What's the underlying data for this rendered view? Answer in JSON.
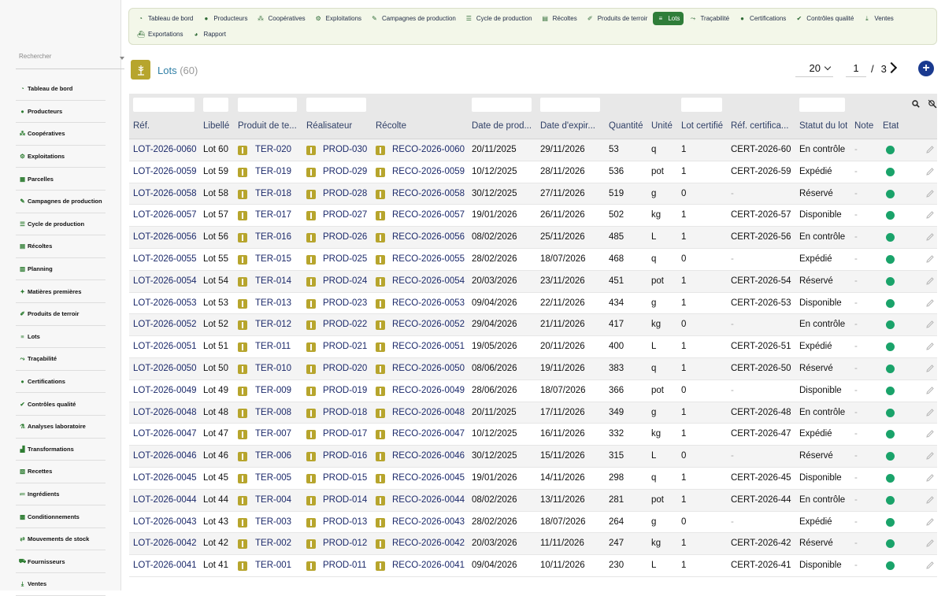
{
  "sidebar": {
    "search_placeholder": "Rechercher",
    "items": [
      {
        "label": "Tableau de bord",
        "icon": "dashboard-icon"
      },
      {
        "label": "Producteurs",
        "icon": "person-icon"
      },
      {
        "label": "Coopératives",
        "icon": "group-icon"
      },
      {
        "label": "Exploitations",
        "icon": "tractor-icon"
      },
      {
        "label": "Parcelles",
        "icon": "plot-icon"
      },
      {
        "label": "Campagnes de production",
        "icon": "campaign-icon"
      },
      {
        "label": "Cycle de production",
        "icon": "list-icon"
      },
      {
        "label": "Récoltes",
        "icon": "harvest-icon"
      },
      {
        "label": "Planning",
        "icon": "calendar-icon"
      },
      {
        "label": "Matières premières",
        "icon": "raw-material-icon"
      },
      {
        "label": "Produits de terroir",
        "icon": "product-icon"
      },
      {
        "label": "Lots",
        "icon": "lots-icon"
      },
      {
        "label": "Traçabilité",
        "icon": "trace-icon"
      },
      {
        "label": "Certifications",
        "icon": "certification-icon"
      },
      {
        "label": "Contrôles qualité",
        "icon": "quality-icon"
      },
      {
        "label": "Analyses laboratoire",
        "icon": "lab-icon"
      },
      {
        "label": "Transformations",
        "icon": "transform-icon"
      },
      {
        "label": "Recettes",
        "icon": "recipe-icon"
      },
      {
        "label": "Ingrédients",
        "icon": "ingredient-icon"
      },
      {
        "label": "Conditionnements",
        "icon": "packaging-icon"
      },
      {
        "label": "Mouvements de stock",
        "icon": "stock-icon"
      },
      {
        "label": "Fournisseurs",
        "icon": "supplier-icon"
      },
      {
        "label": "Ventes",
        "icon": "sales-icon"
      }
    ]
  },
  "topnav": {
    "row1": [
      {
        "label": "Tableau de bord",
        "icon": "dashboard-icon",
        "active": false
      },
      {
        "label": "Producteurs",
        "icon": "person-icon",
        "active": false
      },
      {
        "label": "Coopératives",
        "icon": "group-icon",
        "active": false
      },
      {
        "label": "Exploitations",
        "icon": "tractor-icon",
        "active": false
      },
      {
        "label": "Campagnes de production",
        "icon": "campaign-icon",
        "active": false
      },
      {
        "label": "Cycle de production",
        "icon": "list-icon",
        "active": false
      },
      {
        "label": "Récoltes",
        "icon": "harvest-icon",
        "active": false
      },
      {
        "label": "Produits de terroir",
        "icon": "product-icon",
        "active": false
      },
      {
        "label": "Lots",
        "icon": "lots-icon",
        "active": true
      },
      {
        "label": "Traçabilité",
        "icon": "trace-icon",
        "active": false
      },
      {
        "label": "Certifications",
        "icon": "certification-icon",
        "active": false
      },
      {
        "label": "Contrôles qualité",
        "icon": "quality-icon",
        "active": false
      },
      {
        "label": "Ventes",
        "icon": "sales-icon",
        "active": false
      }
    ],
    "row2": [
      {
        "label": "Exportations",
        "icon": "export-icon",
        "active": false
      },
      {
        "label": "Rapport",
        "icon": "report-icon",
        "active": false
      }
    ]
  },
  "page": {
    "title": "Lots",
    "count": "(60)"
  },
  "pagination": {
    "page_size": "20",
    "current_page": "1",
    "separator": "/",
    "total_pages": "3"
  },
  "table": {
    "columns": [
      "Réf.",
      "Libellé",
      "Produit de te...",
      "Réalisateur",
      "Récolte",
      "Date de prod...",
      "Date d'expir...",
      "Quantité",
      "Unité",
      "Lot certifié",
      "Réf. certifica...",
      "Statut du lot",
      "Note",
      "État"
    ],
    "rows": [
      {
        "ref": "LOT-2026-0060",
        "libelle": "Lot 60",
        "produit": "TER-020",
        "realisateur": "PROD-030",
        "recolte": "RECO-2026-0060",
        "date_prod": "20/11/2025",
        "date_exp": "29/11/2026",
        "quantite": "53",
        "unite": "q",
        "certifie": "1",
        "ref_cert": "CERT-2026-60",
        "statut": "En contrôle",
        "note": "-"
      },
      {
        "ref": "LOT-2026-0059",
        "libelle": "Lot 59",
        "produit": "TER-019",
        "realisateur": "PROD-029",
        "recolte": "RECO-2026-0059",
        "date_prod": "10/12/2025",
        "date_exp": "28/11/2026",
        "quantite": "536",
        "unite": "pot",
        "certifie": "1",
        "ref_cert": "CERT-2026-59",
        "statut": "Expédié",
        "note": "-"
      },
      {
        "ref": "LOT-2026-0058",
        "libelle": "Lot 58",
        "produit": "TER-018",
        "realisateur": "PROD-028",
        "recolte": "RECO-2026-0058",
        "date_prod": "30/12/2025",
        "date_exp": "27/11/2026",
        "quantite": "519",
        "unite": "g",
        "certifie": "0",
        "ref_cert": "-",
        "statut": "Réservé",
        "note": "-"
      },
      {
        "ref": "LOT-2026-0057",
        "libelle": "Lot 57",
        "produit": "TER-017",
        "realisateur": "PROD-027",
        "recolte": "RECO-2026-0057",
        "date_prod": "19/01/2026",
        "date_exp": "26/11/2026",
        "quantite": "502",
        "unite": "kg",
        "certifie": "1",
        "ref_cert": "CERT-2026-57",
        "statut": "Disponible",
        "note": "-"
      },
      {
        "ref": "LOT-2026-0056",
        "libelle": "Lot 56",
        "produit": "TER-016",
        "realisateur": "PROD-026",
        "recolte": "RECO-2026-0056",
        "date_prod": "08/02/2026",
        "date_exp": "25/11/2026",
        "quantite": "485",
        "unite": "L",
        "certifie": "1",
        "ref_cert": "CERT-2026-56",
        "statut": "En contrôle",
        "note": "-"
      },
      {
        "ref": "LOT-2026-0055",
        "libelle": "Lot 55",
        "produit": "TER-015",
        "realisateur": "PROD-025",
        "recolte": "RECO-2026-0055",
        "date_prod": "28/02/2026",
        "date_exp": "18/07/2026",
        "quantite": "468",
        "unite": "q",
        "certifie": "0",
        "ref_cert": "-",
        "statut": "Expédié",
        "note": "-"
      },
      {
        "ref": "LOT-2026-0054",
        "libelle": "Lot 54",
        "produit": "TER-014",
        "realisateur": "PROD-024",
        "recolte": "RECO-2026-0054",
        "date_prod": "20/03/2026",
        "date_exp": "23/11/2026",
        "quantite": "451",
        "unite": "pot",
        "certifie": "1",
        "ref_cert": "CERT-2026-54",
        "statut": "Réservé",
        "note": "-"
      },
      {
        "ref": "LOT-2026-0053",
        "libelle": "Lot 53",
        "produit": "TER-013",
        "realisateur": "PROD-023",
        "recolte": "RECO-2026-0053",
        "date_prod": "09/04/2026",
        "date_exp": "22/11/2026",
        "quantite": "434",
        "unite": "g",
        "certifie": "1",
        "ref_cert": "CERT-2026-53",
        "statut": "Disponible",
        "note": "-"
      },
      {
        "ref": "LOT-2026-0052",
        "libelle": "Lot 52",
        "produit": "TER-012",
        "realisateur": "PROD-022",
        "recolte": "RECO-2026-0052",
        "date_prod": "29/04/2026",
        "date_exp": "21/11/2026",
        "quantite": "417",
        "unite": "kg",
        "certifie": "0",
        "ref_cert": "-",
        "statut": "En contrôle",
        "note": "-"
      },
      {
        "ref": "LOT-2026-0051",
        "libelle": "Lot 51",
        "produit": "TER-011",
        "realisateur": "PROD-021",
        "recolte": "RECO-2026-0051",
        "date_prod": "19/05/2026",
        "date_exp": "20/11/2026",
        "quantite": "400",
        "unite": "L",
        "certifie": "1",
        "ref_cert": "CERT-2026-51",
        "statut": "Expédié",
        "note": "-"
      },
      {
        "ref": "LOT-2026-0050",
        "libelle": "Lot 50",
        "produit": "TER-010",
        "realisateur": "PROD-020",
        "recolte": "RECO-2026-0050",
        "date_prod": "08/06/2026",
        "date_exp": "19/11/2026",
        "quantite": "383",
        "unite": "q",
        "certifie": "1",
        "ref_cert": "CERT-2026-50",
        "statut": "Réservé",
        "note": "-"
      },
      {
        "ref": "LOT-2026-0049",
        "libelle": "Lot 49",
        "produit": "TER-009",
        "realisateur": "PROD-019",
        "recolte": "RECO-2026-0049",
        "date_prod": "28/06/2026",
        "date_exp": "18/07/2026",
        "quantite": "366",
        "unite": "pot",
        "certifie": "0",
        "ref_cert": "-",
        "statut": "Disponible",
        "note": "-"
      },
      {
        "ref": "LOT-2026-0048",
        "libelle": "Lot 48",
        "produit": "TER-008",
        "realisateur": "PROD-018",
        "recolte": "RECO-2026-0048",
        "date_prod": "20/11/2025",
        "date_exp": "17/11/2026",
        "quantite": "349",
        "unite": "g",
        "certifie": "1",
        "ref_cert": "CERT-2026-48",
        "statut": "En contrôle",
        "note": "-"
      },
      {
        "ref": "LOT-2026-0047",
        "libelle": "Lot 47",
        "produit": "TER-007",
        "realisateur": "PROD-017",
        "recolte": "RECO-2026-0047",
        "date_prod": "10/12/2025",
        "date_exp": "16/11/2026",
        "quantite": "332",
        "unite": "kg",
        "certifie": "1",
        "ref_cert": "CERT-2026-47",
        "statut": "Expédié",
        "note": "-"
      },
      {
        "ref": "LOT-2026-0046",
        "libelle": "Lot 46",
        "produit": "TER-006",
        "realisateur": "PROD-016",
        "recolte": "RECO-2026-0046",
        "date_prod": "30/12/2025",
        "date_exp": "15/11/2026",
        "quantite": "315",
        "unite": "L",
        "certifie": "0",
        "ref_cert": "-",
        "statut": "Réservé",
        "note": "-"
      },
      {
        "ref": "LOT-2026-0045",
        "libelle": "Lot 45",
        "produit": "TER-005",
        "realisateur": "PROD-015",
        "recolte": "RECO-2026-0045",
        "date_prod": "19/01/2026",
        "date_exp": "14/11/2026",
        "quantite": "298",
        "unite": "q",
        "certifie": "1",
        "ref_cert": "CERT-2026-45",
        "statut": "Disponible",
        "note": "-"
      },
      {
        "ref": "LOT-2026-0044",
        "libelle": "Lot 44",
        "produit": "TER-004",
        "realisateur": "PROD-014",
        "recolte": "RECO-2026-0044",
        "date_prod": "08/02/2026",
        "date_exp": "13/11/2026",
        "quantite": "281",
        "unite": "pot",
        "certifie": "1",
        "ref_cert": "CERT-2026-44",
        "statut": "En contrôle",
        "note": "-"
      },
      {
        "ref": "LOT-2026-0043",
        "libelle": "Lot 43",
        "produit": "TER-003",
        "realisateur": "PROD-013",
        "recolte": "RECO-2026-0043",
        "date_prod": "28/02/2026",
        "date_exp": "18/07/2026",
        "quantite": "264",
        "unite": "g",
        "certifie": "0",
        "ref_cert": "-",
        "statut": "Expédié",
        "note": "-"
      },
      {
        "ref": "LOT-2026-0042",
        "libelle": "Lot 42",
        "produit": "TER-002",
        "realisateur": "PROD-012",
        "recolte": "RECO-2026-0042",
        "date_prod": "20/03/2026",
        "date_exp": "11/11/2026",
        "quantite": "247",
        "unite": "kg",
        "certifie": "1",
        "ref_cert": "CERT-2026-42",
        "statut": "Réservé",
        "note": "-"
      },
      {
        "ref": "LOT-2026-0041",
        "libelle": "Lot 41",
        "produit": "TER-001",
        "realisateur": "PROD-011",
        "recolte": "RECO-2026-0041",
        "date_prod": "09/04/2026",
        "date_exp": "10/11/2026",
        "quantite": "230",
        "unite": "L",
        "certifie": "1",
        "ref_cert": "CERT-2026-41",
        "statut": "Disponible",
        "note": "-"
      }
    ]
  },
  "colors": {
    "accent_green": "#2f7d39",
    "link_blue": "#1c2a6b",
    "title_blue": "#2f7fa6",
    "status_green": "#1aa36a",
    "add_button": "#1a3a8f",
    "product_icon": "#b7a52d"
  }
}
